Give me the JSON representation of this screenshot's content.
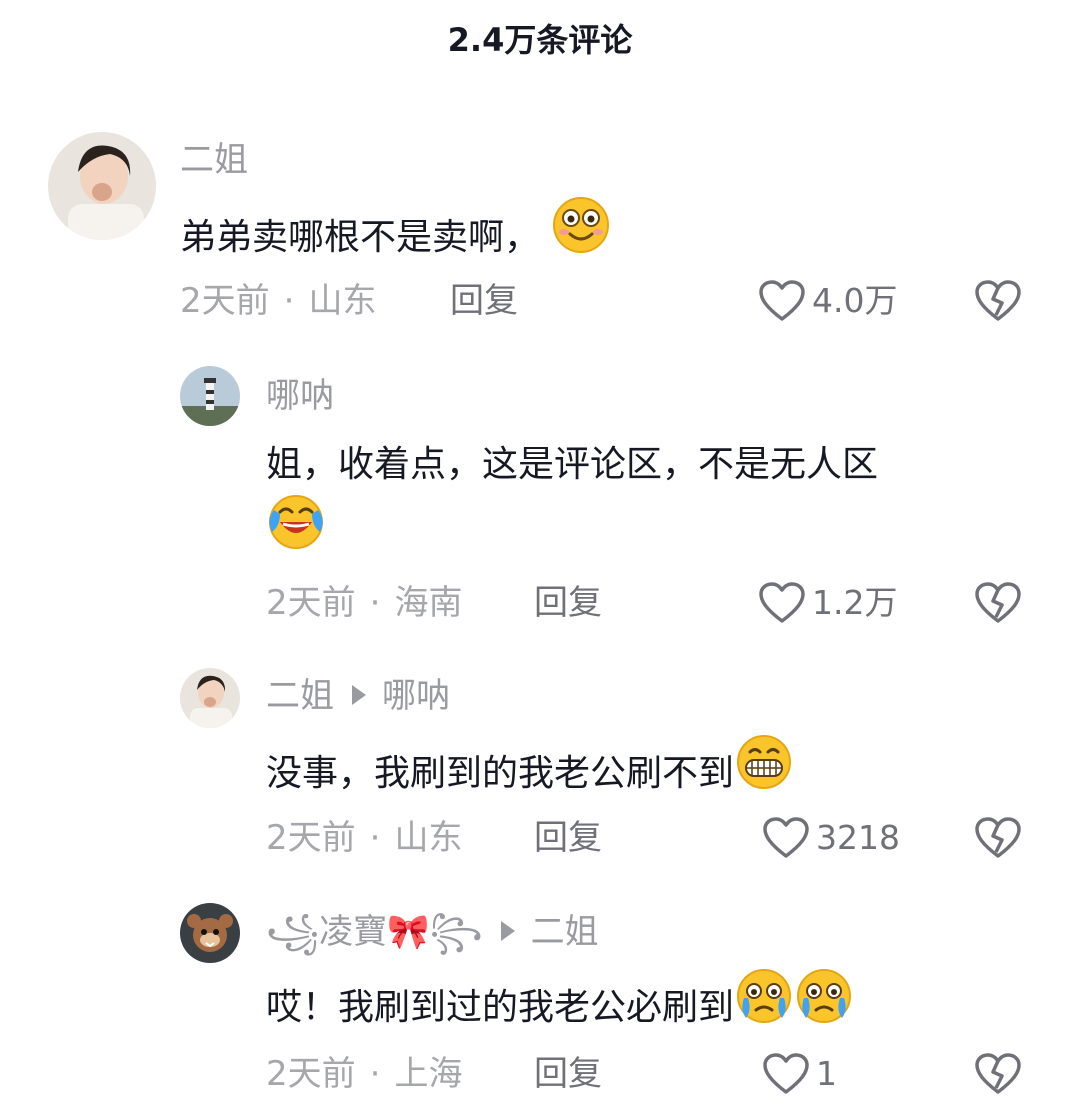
{
  "header": {
    "title": "2.4万条评论"
  },
  "comments": [
    {
      "username": "二姐",
      "text": "弟弟卖哪根不是卖啊，",
      "emoji": "shy-smile",
      "time": "2天前",
      "location": "山东",
      "reply_label": "回复",
      "likes": "4.0万"
    },
    {
      "username": "哪呐",
      "text": "姐，收着点，这是评论区，不是无人区",
      "emoji": "laugh-cry",
      "time": "2天前",
      "location": "海南",
      "reply_label": "回复",
      "likes": "1.2万"
    },
    {
      "username": "二姐",
      "reply_to": "哪呐",
      "text": "没事，我刷到的我老公刷不到",
      "emoji": "grin",
      "time": "2天前",
      "location": "山东",
      "reply_label": "回复",
      "likes": "3218"
    },
    {
      "username": "꧁凌寶🎀꧂",
      "reply_to": "二姐",
      "text": "哎！我刷到过的我老公必刷到",
      "emoji": "teary-pleading",
      "time": "2天前",
      "location": "上海",
      "reply_label": "回复",
      "likes": "1"
    }
  ],
  "colors": {
    "text_primary": "#161823",
    "text_secondary": "#9a9ba1",
    "emoji_yellow": "#f9c52a"
  }
}
